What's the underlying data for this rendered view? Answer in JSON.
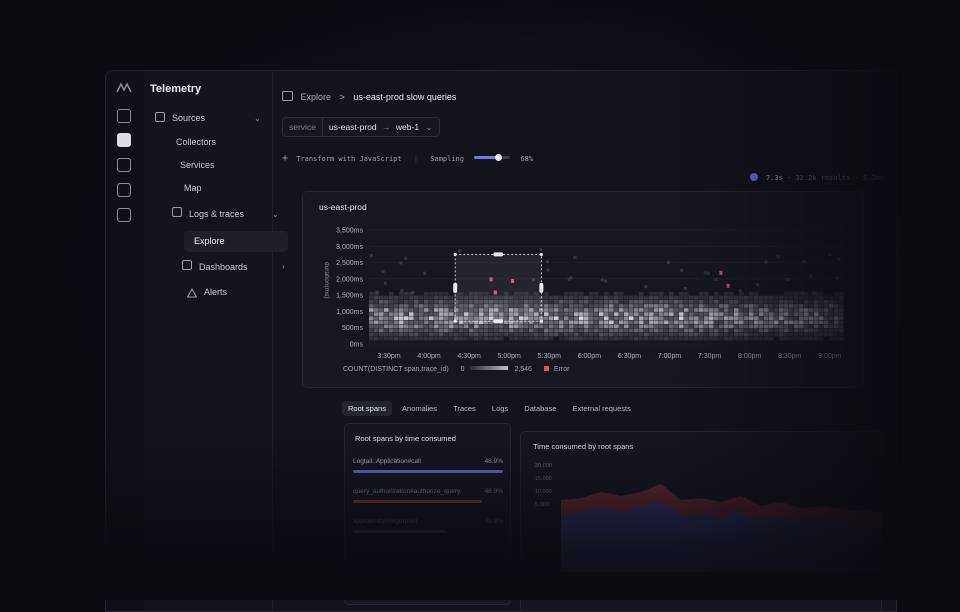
{
  "sidebar": {
    "title": "Telemetry",
    "items": [
      {
        "label": "Sources",
        "icon": "cube-icon"
      },
      {
        "label": "Collectors"
      },
      {
        "label": "Services"
      },
      {
        "label": "Map"
      },
      {
        "label": "Logs & traces",
        "icon": "terminal-icon"
      },
      {
        "label": "Explore"
      },
      {
        "label": "Dashboards",
        "icon": "dashboard-icon"
      },
      {
        "label": "Alerts",
        "icon": "alert-icon"
      }
    ]
  },
  "breadcrumb": {
    "parent": "Explore",
    "separator": ">",
    "current": "us-east-prod slow queries"
  },
  "filter": {
    "key": "service",
    "value1": "us-east-prod",
    "arrow": "→",
    "value2": "web-1"
  },
  "toolbar": {
    "transform_label": "Transform with JavaScript",
    "sampling_label": "Sampling",
    "sampling_value": "68%",
    "sampling_fraction": 0.68
  },
  "stats": {
    "time": "7.3s",
    "results": "32.2k results",
    "extra": "5.3ms"
  },
  "heatmap": {
    "title": "us-east-prod",
    "legend_metric": "COUNT(DISTINCT span.trace_id)",
    "legend_min": "0",
    "legend_max": "2,546",
    "legend_error": "Error",
    "y_axis_title": "duration(ms)"
  },
  "tabs": [
    "Root spans",
    "Anomalies",
    "Traces",
    "Logs",
    "Database",
    "External requests"
  ],
  "root_spans": {
    "title": "Root spans by time consumed",
    "rows": [
      {
        "name": "Logtail::Application#call",
        "pct": "48.9%",
        "fraction": 0.489,
        "color": "#6b6fd9"
      },
      {
        "name": "query_authorization#authorize_query",
        "pct": "48.9%",
        "fraction": 0.42,
        "color": "#c2414a"
      },
      {
        "name": "appIdentity#fingerprint",
        "pct": "48.9%",
        "fraction": 0.3,
        "color": "#6b6fd9"
      }
    ]
  },
  "time_consumed": {
    "title": "Time consumed by root spans",
    "y_ticks": [
      "20,000",
      "15,000",
      "10,000",
      "5,000"
    ]
  },
  "colors": {
    "accent": "#7479e8",
    "error": "#e0506a",
    "bg": "#12131b"
  },
  "chart_data": {
    "type": "heatmap",
    "title": "us-east-prod",
    "ylabel": "duration(ms)",
    "y_ticks": [
      "3,500ms",
      "3,000ms",
      "2,500ms",
      "2,000ms",
      "1,500ms",
      "1,000ms",
      "500ms",
      "0ms"
    ],
    "x_ticks": [
      "3:30pm",
      "4:00pm",
      "4:30pm",
      "5:00pm",
      "5:30pm",
      "6:00pm",
      "6:30pm",
      "7:00pm",
      "7:30pm",
      "8:00pm",
      "8:30pm",
      "9:00pm"
    ],
    "ylim": [
      0,
      3500
    ],
    "color_range": [
      0,
      2546
    ],
    "selection": {
      "x_from": "4:30pm",
      "x_to": "5:30pm",
      "y_from_ms": 700,
      "y_to_ms": 2750
    },
    "error_points": [
      {
        "x": "4:55pm",
        "y_ms": 2000
      },
      {
        "x": "4:58pm",
        "y_ms": 1600
      },
      {
        "x": "5:10pm",
        "y_ms": 1950
      },
      {
        "x": "7:35pm",
        "y_ms": 2200
      },
      {
        "x": "7:40pm",
        "y_ms": 1800
      }
    ]
  }
}
